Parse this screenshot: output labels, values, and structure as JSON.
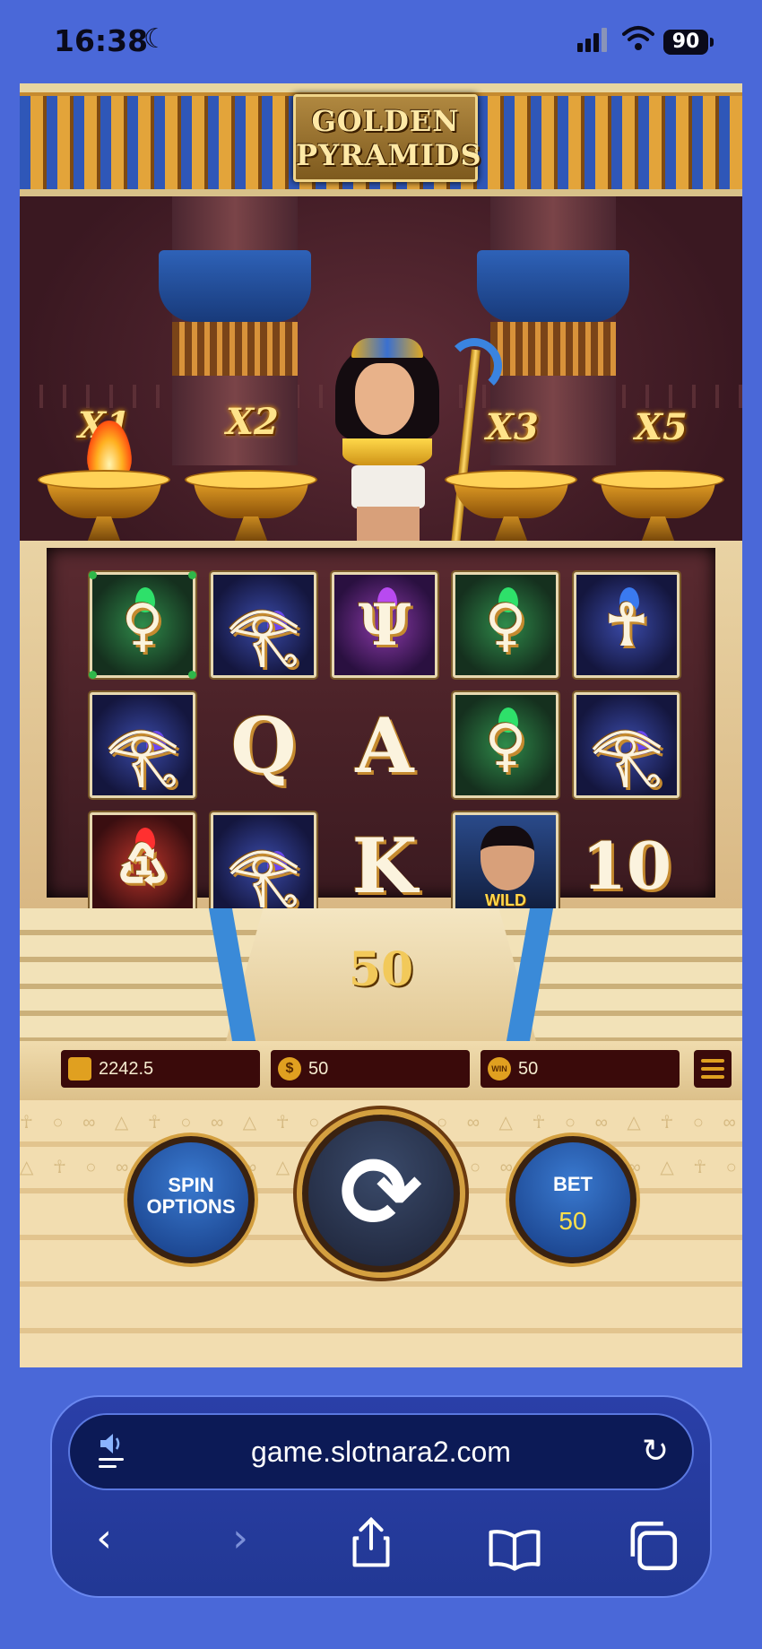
{
  "status_bar": {
    "time": "16:38",
    "battery": "90"
  },
  "game": {
    "title_line1": "GOLDEN",
    "title_line2": "PYRAMIDS",
    "multipliers": [
      "X1",
      "X2",
      "X3",
      "X5"
    ],
    "reels": [
      [
        {
          "symbol": "emerald-ankh-knot",
          "glyph": "♀",
          "bg": "bg-green"
        },
        {
          "symbol": "eye-of-horus",
          "glyph": "𓂀",
          "bg": "bg-blue"
        },
        {
          "symbol": "amethyst-chalice",
          "glyph": "Ψ",
          "bg": "bg-purple"
        },
        {
          "symbol": "emerald-ankh-knot",
          "glyph": "♀",
          "bg": "bg-green"
        },
        {
          "symbol": "sapphire-ankh",
          "glyph": "☥",
          "bg": "bg-blue"
        }
      ],
      [
        {
          "symbol": "eye-of-horus",
          "glyph": "𓂀",
          "bg": "bg-blue"
        },
        {
          "symbol": "card-queen",
          "glyph": "Q",
          "bg": ""
        },
        {
          "symbol": "card-ace",
          "glyph": "A",
          "bg": ""
        },
        {
          "symbol": "emerald-ankh-knot",
          "glyph": "♀",
          "bg": "bg-green"
        },
        {
          "symbol": "eye-of-horus",
          "glyph": "𓂀",
          "bg": "bg-blue"
        }
      ],
      [
        {
          "symbol": "ruby-scarab-seal",
          "glyph": "♳",
          "bg": "bg-red"
        },
        {
          "symbol": "eye-of-horus",
          "glyph": "𓂀",
          "bg": "bg-blue"
        },
        {
          "symbol": "card-king",
          "glyph": "K",
          "bg": ""
        },
        {
          "symbol": "wild-cleopatra",
          "glyph": "",
          "bg": "bg-wild",
          "label": "WILD"
        },
        {
          "symbol": "card-ten",
          "glyph": "10",
          "bg": ""
        }
      ]
    ],
    "total_win": "50",
    "balance": "2242.5",
    "bet_amount": "50",
    "win_amount": "50",
    "win_badge": "WIN",
    "spin_options_label_1": "SPIN",
    "spin_options_label_2": "OPTIONS",
    "bet_label": "BET",
    "bet_value": "50"
  },
  "browser": {
    "url": "game.slotnara2.com"
  }
}
